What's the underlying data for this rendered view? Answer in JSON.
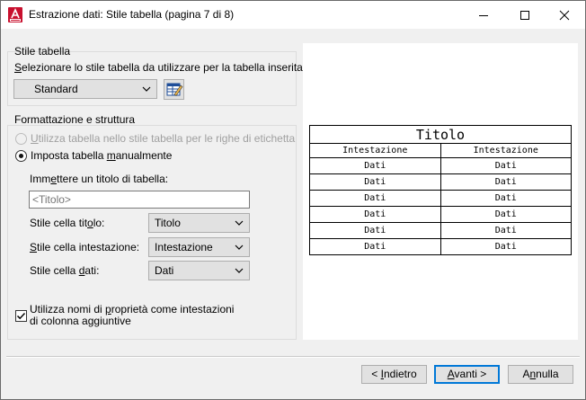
{
  "window": {
    "title": "Estrazione dati: Stile tabella (pagina 7 di 8)",
    "icon": "autocad-app-icon",
    "controls": [
      "minimize-icon",
      "maximize-icon",
      "close-icon"
    ]
  },
  "table_style": {
    "group_label": "Stile tabella",
    "prompt_pre": "",
    "prompt_u": "S",
    "prompt_post": "elezionare lo stile tabella da utilizzare per la tabella inserita:",
    "selected": "Standard",
    "edit_icon": "table-style-edit-icon"
  },
  "format": {
    "group_label": "Formattazione e struttura",
    "radio_label_style": {
      "pre": "",
      "u": "U",
      "post": "tilizza tabella nello stile tabella per le righe di etichetta"
    },
    "radio_label_manual": {
      "pre": "Imposta tabella ",
      "u": "m",
      "post": "anualmente"
    },
    "radio_style_selected": false,
    "radio_style_disabled": true,
    "radio_manual_selected": true,
    "title_prompt": {
      "pre": "Imm",
      "u": "e",
      "post": "ttere un titolo di tabella:"
    },
    "title_placeholder": "<Titolo>",
    "title_value": "",
    "title_cell": {
      "pre": "Stile cella tit",
      "u": "o",
      "post": "lo:",
      "value": "Titolo"
    },
    "header_cell": {
      "pre": "",
      "u": "S",
      "post": "tile cella intestazione:",
      "value": "Intestazione"
    },
    "data_cell": {
      "pre": "Stile cella ",
      "u": "d",
      "post": "ati:",
      "value": "Dati"
    },
    "checkbox_line1": {
      "pre": "Utilizza nomi di ",
      "u": "p",
      "post": "roprietà come intestazioni"
    },
    "checkbox_line2": "di colonna aggiuntive",
    "checkbox_checked": true
  },
  "preview": {
    "title": "Titolo",
    "headers": [
      "Intestazione",
      "Intestazione"
    ],
    "rows": [
      [
        "Dati",
        "Dati"
      ],
      [
        "Dati",
        "Dati"
      ],
      [
        "Dati",
        "Dati"
      ],
      [
        "Dati",
        "Dati"
      ],
      [
        "Dati",
        "Dati"
      ],
      [
        "Dati",
        "Dati"
      ]
    ]
  },
  "buttons": {
    "back": {
      "pre": "< ",
      "u": "I",
      "post": "ndietro"
    },
    "next": {
      "pre": "",
      "u": "A",
      "post": "vanti >"
    },
    "cancel": {
      "pre": "A",
      "u": "n",
      "post": "nulla"
    }
  },
  "colors": {
    "accent": "#0078d7",
    "app_icon": "#c8102e"
  }
}
